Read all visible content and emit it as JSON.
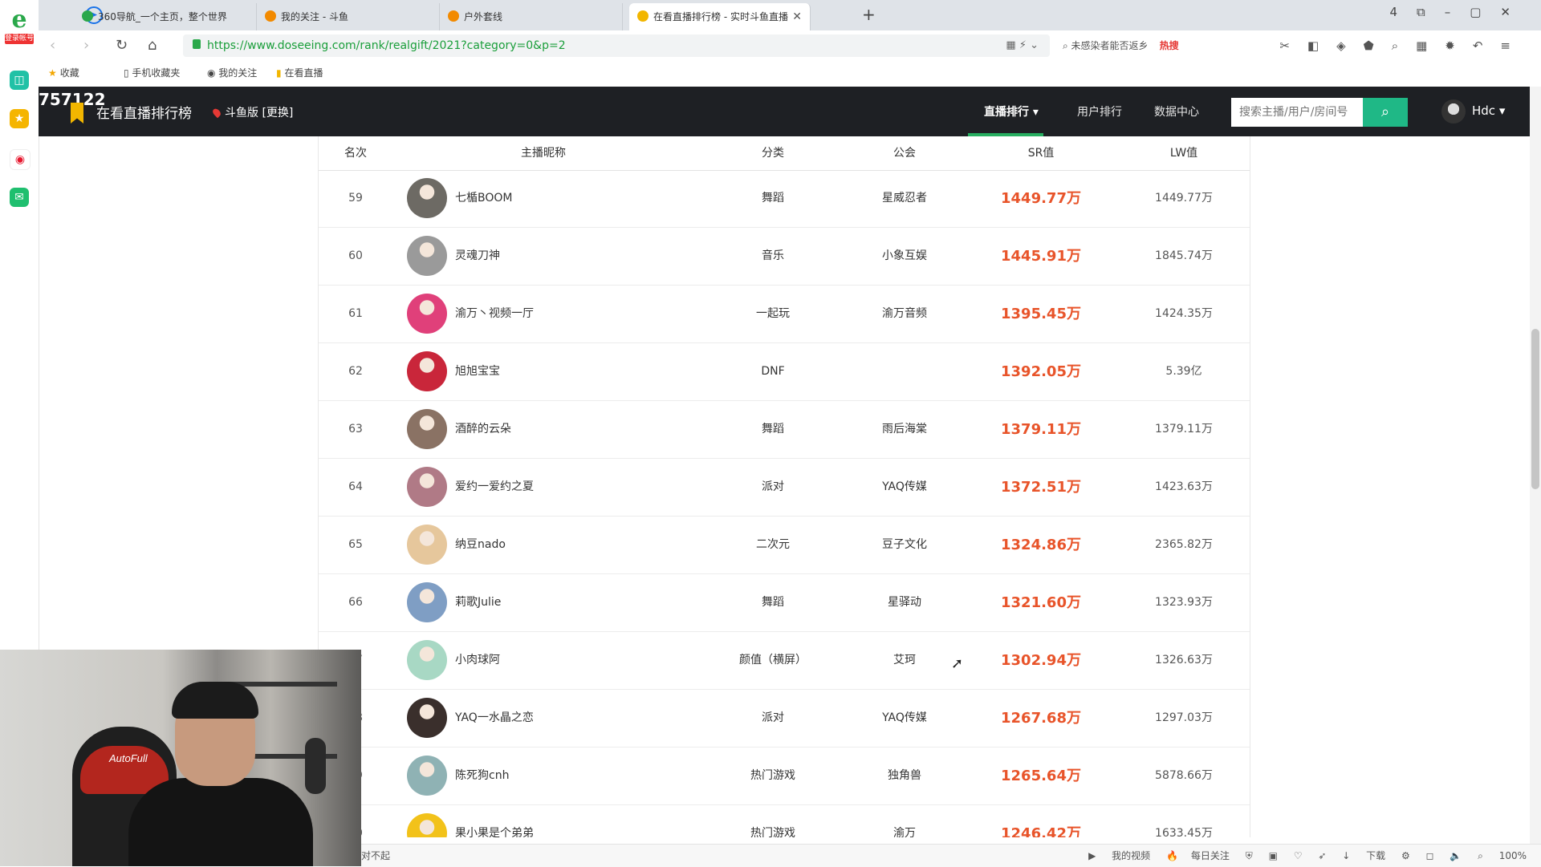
{
  "browser": {
    "tabs": [
      {
        "title": "360导航_一个主页，整个世界",
        "icon_color": "#2aa84a"
      },
      {
        "title": "我的关注 - 斗鱼",
        "icon_color": "#f28a00"
      },
      {
        "title": "户外套线",
        "icon_color": "#f28a00"
      },
      {
        "title": "在看直播排行榜 - 实时斗鱼直播",
        "icon_color": "#f2b600"
      }
    ],
    "new_tab": "+",
    "url": "https://www.doseeing.com/rank/realgift/2021?category=0&p=2",
    "search_hint": "未感染者能否返乡",
    "hot_label": "热搜",
    "bookmarks": [
      "收藏",
      "手机收藏夹",
      "我的关注",
      "在看直播"
    ],
    "sidebar_logo_tag": "登录帐号",
    "win_badge": "4"
  },
  "site": {
    "viewer_count": "757122",
    "title": "在看直播排行榜",
    "region": "斗鱼版 [更换]",
    "nav": [
      {
        "label": "直播排行 ▾",
        "active": true
      },
      {
        "label": "用户排行",
        "active": false
      },
      {
        "label": "数据中心",
        "active": false
      }
    ],
    "search_placeholder": "搜索主播/用户/房间号",
    "user_name": "Hdc ▾"
  },
  "table": {
    "headers": [
      "名次",
      "主播昵称",
      "分类",
      "公会",
      "SR值",
      "LW值"
    ],
    "rows": [
      {
        "rank": "59",
        "name": "七楯BOOM",
        "category": "舞蹈",
        "guild": "星威忍者",
        "sr": "1449.77万",
        "lw": "1449.77万",
        "avatar_color": "#6d6a64"
      },
      {
        "rank": "60",
        "name": "灵魂刀神",
        "category": "音乐",
        "guild": "小象互娱",
        "sr": "1445.91万",
        "lw": "1845.74万",
        "avatar_color": "#9a9a9a"
      },
      {
        "rank": "61",
        "name": "渝万丶视频一厅",
        "category": "一起玩",
        "guild": "渝万音频",
        "sr": "1395.45万",
        "lw": "1424.35万",
        "avatar_color": "#e0407a"
      },
      {
        "rank": "62",
        "name": "旭旭宝宝",
        "category": "DNF",
        "guild": "",
        "sr": "1392.05万",
        "lw": "5.39亿",
        "avatar_color": "#c9263a"
      },
      {
        "rank": "63",
        "name": "酒醉的云朵",
        "category": "舞蹈",
        "guild": "雨后海棠",
        "sr": "1379.11万",
        "lw": "1379.11万",
        "avatar_color": "#8a7264"
      },
      {
        "rank": "64",
        "name": "爱约一爱约之夏",
        "category": "派对",
        "guild": "YAQ传媒",
        "sr": "1372.51万",
        "lw": "1423.63万",
        "avatar_color": "#b07a86"
      },
      {
        "rank": "65",
        "name": "纳豆nado",
        "category": "二次元",
        "guild": "豆子文化",
        "sr": "1324.86万",
        "lw": "2365.82万",
        "avatar_color": "#e6c79c"
      },
      {
        "rank": "66",
        "name": "莉歌Julie",
        "category": "舞蹈",
        "guild": "星驿动",
        "sr": "1321.60万",
        "lw": "1323.93万",
        "avatar_color": "#7f9ec4"
      },
      {
        "rank": "67",
        "name": "小肉球阿",
        "category": "颜值（横屏）",
        "guild": "艾珂",
        "sr": "1302.94万",
        "lw": "1326.63万",
        "avatar_color": "#a8d8c4"
      },
      {
        "rank": "68",
        "name": "YAQ一水晶之恋",
        "category": "派对",
        "guild": "YAQ传媒",
        "sr": "1267.68万",
        "lw": "1297.03万",
        "avatar_color": "#3a2f2c"
      },
      {
        "rank": "69",
        "name": "陈死狗cnh",
        "category": "热门游戏",
        "guild": "独角兽",
        "sr": "1265.64万",
        "lw": "5878.66万",
        "avatar_color": "#8fb2b4"
      },
      {
        "rank": "70",
        "name": "果小果是个弟弟",
        "category": "热门游戏",
        "guild": "渝万",
        "sr": "1246.42万",
        "lw": "1633.45万",
        "avatar_color": "#f2c21a"
      }
    ]
  },
  "webcam": {
    "chair_brand": "AutoFull"
  },
  "status_bar": {
    "left_text": "对不起",
    "items": [
      "我的视频",
      "每日关注",
      "下载",
      "100%"
    ]
  },
  "colors": {
    "accent_green": "#1fb886",
    "sr_orange": "#e8542a",
    "header_dark": "#1e2024"
  }
}
